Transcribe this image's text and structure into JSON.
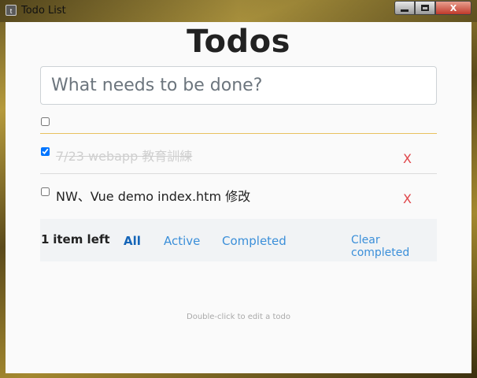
{
  "window": {
    "title": "Todo List",
    "app_icon": "app-icon",
    "minimize_icon": "minimize-icon",
    "maximize_icon": "maximize-icon",
    "close_label": "X"
  },
  "app": {
    "title": "Todos",
    "new_todo_placeholder": "What needs to be done?",
    "new_todo_value": "",
    "toggle_all_checked": false
  },
  "todos": [
    {
      "text": "7/23 webapp 教育訓練",
      "completed": true,
      "delete_label": "X"
    },
    {
      "text": "NW、Vue demo index.htm 修改",
      "completed": false,
      "delete_label": "X"
    }
  ],
  "footer": {
    "count": "1",
    "count_suffix": "item left",
    "filters": [
      "All",
      "Active",
      "Completed"
    ],
    "selected_filter": "All",
    "clear_completed": "Clear completed"
  },
  "info": {
    "hint": "Double-click to edit a todo"
  },
  "colors": {
    "delete": "#e0464a",
    "link": "#3b8fd9",
    "selected_filter": "#1565b8",
    "underline": "#e8c15f"
  }
}
